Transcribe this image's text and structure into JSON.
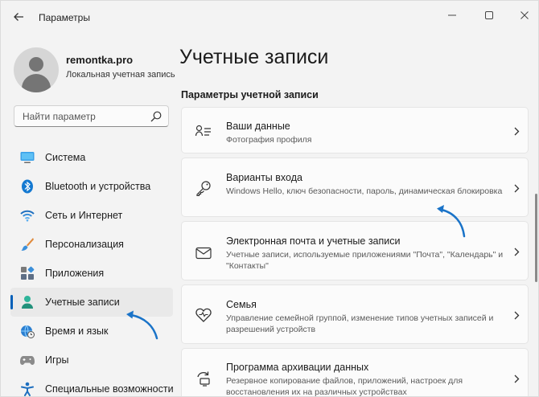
{
  "window": {
    "title": "Параметры"
  },
  "profile": {
    "name": "remontka.pro",
    "account_type": "Локальная учетная запись"
  },
  "search": {
    "placeholder": "Найти параметр"
  },
  "nav": {
    "items": [
      {
        "label": "Система",
        "icon": "monitor-icon"
      },
      {
        "label": "Bluetooth и устройства",
        "icon": "bluetooth-icon"
      },
      {
        "label": "Сеть и Интернет",
        "icon": "wifi-icon"
      },
      {
        "label": "Персонализация",
        "icon": "brush-icon"
      },
      {
        "label": "Приложения",
        "icon": "apps-icon"
      },
      {
        "label": "Учетные записи",
        "icon": "person-icon",
        "active": true
      },
      {
        "label": "Время и язык",
        "icon": "globe-clock-icon"
      },
      {
        "label": "Игры",
        "icon": "gamepad-icon"
      },
      {
        "label": "Специальные возможности",
        "icon": "accessibility-icon"
      }
    ]
  },
  "main": {
    "title": "Учетные записи",
    "section": "Параметры учетной записи",
    "cards": [
      {
        "title": "Ваши данные",
        "desc": "Фотография профиля",
        "icon": "person-card-icon"
      },
      {
        "title": "Варианты входа",
        "desc": "Windows Hello, ключ безопасности, пароль, динамическая блокировка",
        "icon": "key-icon"
      },
      {
        "title": "Электронная почта и учетные записи",
        "desc": "Учетные записи, используемые приложениями \"Почта\", \"Календарь\" и \"Контакты\"",
        "icon": "mail-icon"
      },
      {
        "title": "Семья",
        "desc": "Управление семейной группой, изменение типов учетных записей и разрешений устройств",
        "icon": "heart-icon"
      },
      {
        "title": "Программа архивации данных",
        "desc": "Резервное копирование файлов, приложений, настроек для восстановления их на различных устройствах",
        "icon": "backup-icon"
      }
    ]
  },
  "colors": {
    "accent": "#005fb8",
    "annotation_arrow": "#1a73c8"
  }
}
